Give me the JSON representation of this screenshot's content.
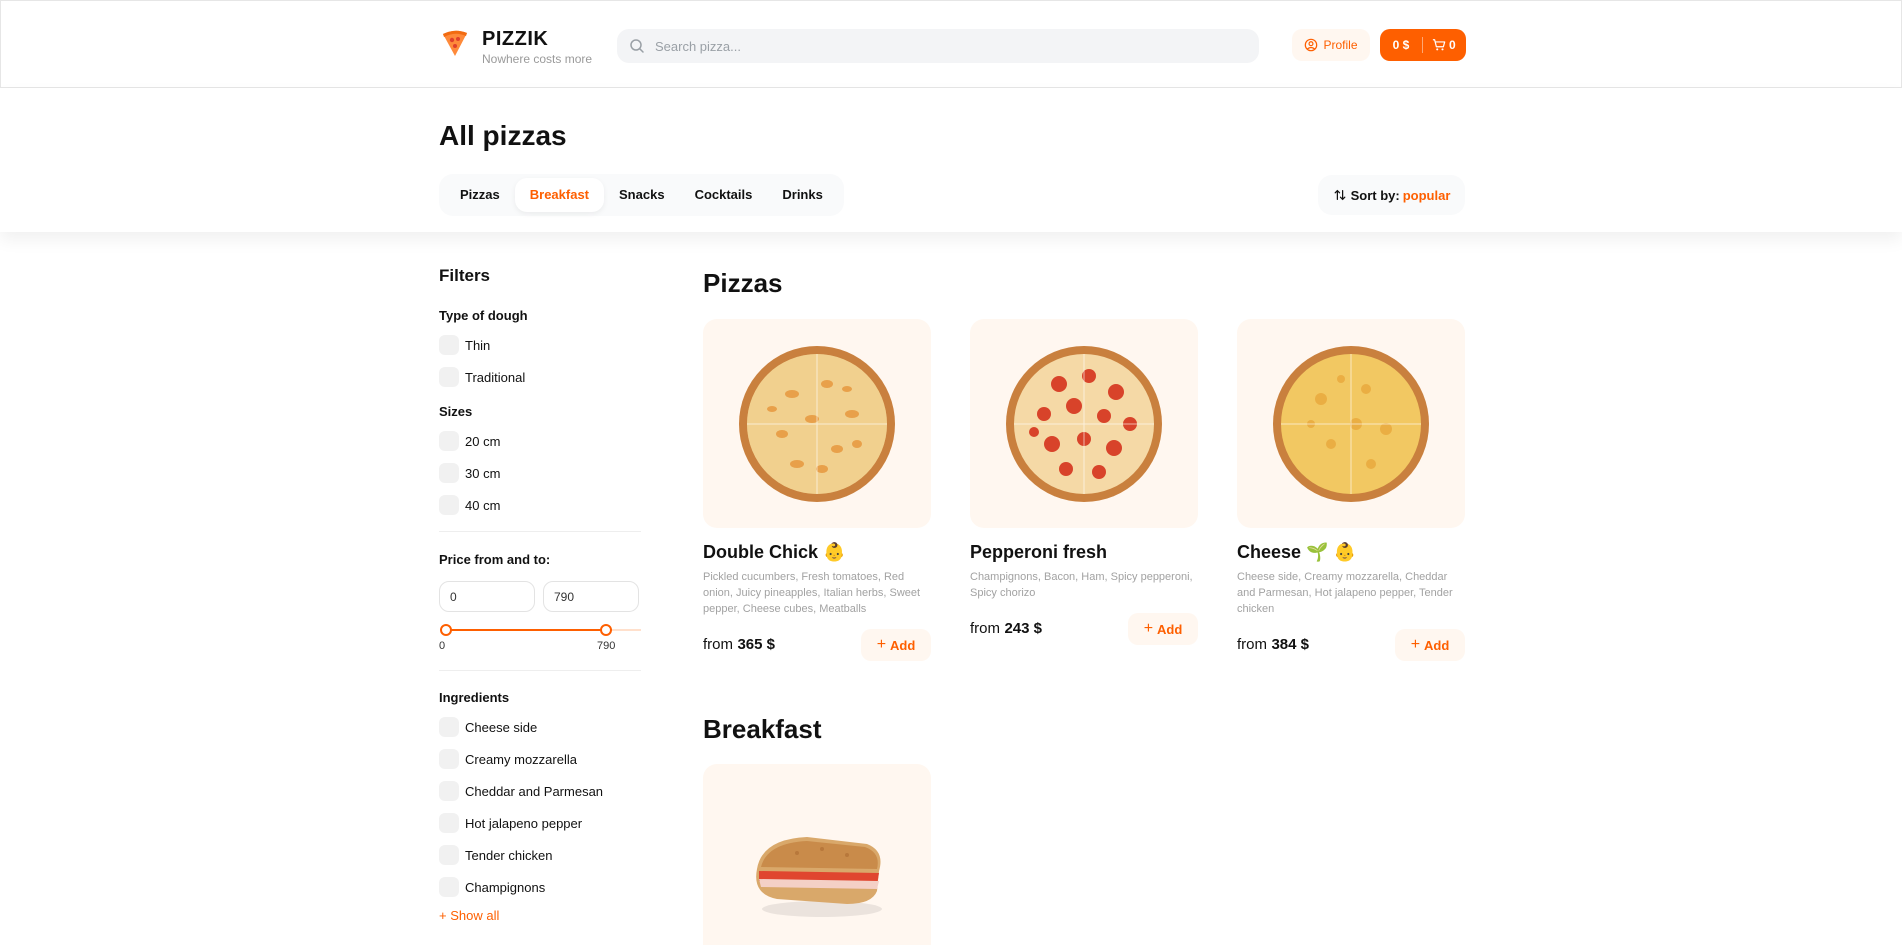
{
  "header": {
    "brand": "PIZZIK",
    "tagline": "Nowhere costs more",
    "search_placeholder": "Search pizza...",
    "profile_label": "Profile",
    "cart_total": "0 $",
    "cart_count": "0"
  },
  "page": {
    "title": "All pizzas"
  },
  "categories": [
    {
      "label": "Pizzas",
      "active": false
    },
    {
      "label": "Breakfast",
      "active": true
    },
    {
      "label": "Snacks",
      "active": false
    },
    {
      "label": "Cocktails",
      "active": false
    },
    {
      "label": "Drinks",
      "active": false
    }
  ],
  "sort": {
    "label": "Sort by:",
    "value": "popular"
  },
  "filters": {
    "title": "Filters",
    "dough": {
      "label": "Type of dough",
      "options": [
        "Thin",
        "Traditional"
      ]
    },
    "sizes": {
      "label": "Sizes",
      "options": [
        "20 cm",
        "30 cm",
        "40 cm"
      ]
    },
    "price": {
      "label": "Price from and to:",
      "from": "0",
      "to": "790",
      "slider_min_label": "0",
      "slider_max_label": "790",
      "range_max": 790
    },
    "ingredients": {
      "label": "Ingredients",
      "options": [
        "Cheese side",
        "Creamy mozzarella",
        "Cheddar and Parmesan",
        "Hot jalapeno pepper",
        "Tender chicken",
        "Champignons"
      ],
      "show_all": "+ Show all"
    }
  },
  "sections": [
    {
      "title": "Pizzas",
      "products": [
        {
          "name": "Double Chick",
          "badges": "👶",
          "description": "Pickled cucumbers, Fresh tomatoes, Red onion, Juicy pineapples, Italian herbs, Sweet pepper, Cheese cubes, Meatballs",
          "price_prefix": "from",
          "price": "365 $",
          "add_label": "Add",
          "image": "pizza-chicken"
        },
        {
          "name": "Pepperoni fresh",
          "badges": "",
          "description": "Champignons, Bacon, Ham, Spicy pepperoni, Spicy chorizo",
          "price_prefix": "from",
          "price": "243 $",
          "add_label": "Add",
          "image": "pizza-pepperoni"
        },
        {
          "name": "Cheese",
          "badges": "🌱 👶",
          "description": "Cheese side, Creamy mozzarella, Cheddar and Parmesan, Hot jalapeno pepper, Tender chicken",
          "price_prefix": "from",
          "price": "384 $",
          "add_label": "Add",
          "image": "pizza-cheese"
        }
      ]
    },
    {
      "title": "Breakfast",
      "products": [
        {
          "name": "",
          "image": "sandwich"
        }
      ]
    }
  ],
  "colors": {
    "accent": "#fe5f00",
    "accent_light": "#fff7f0"
  }
}
